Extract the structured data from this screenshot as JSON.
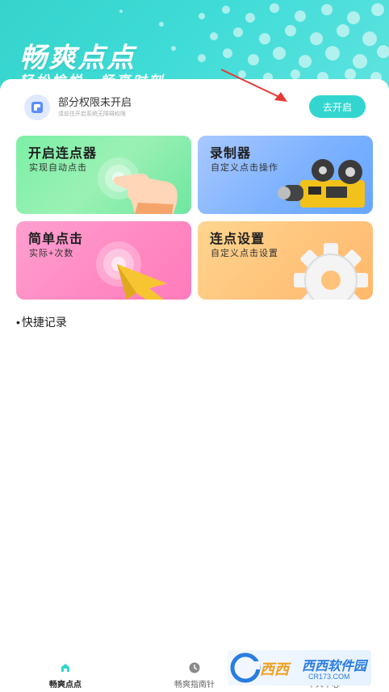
{
  "header": {
    "title": "畅爽点点",
    "subtitle": "轻松愉悦，畅享时刻"
  },
  "permission": {
    "title": "部分权限未开启",
    "subtitle": "请前往开启系统无障碍权限",
    "button_label": "去开启"
  },
  "cards": [
    {
      "title": "开启连点器",
      "subtitle": "实现自动点击",
      "color": "#7cf0a6",
      "icon": "hand-tap-icon"
    },
    {
      "title": "录制器",
      "subtitle": "自定义点击操作",
      "color": "#7db2ff",
      "icon": "film-projector-icon"
    },
    {
      "title": "简单点击",
      "subtitle": "实际+次数",
      "color": "#ff88c2",
      "icon": "cursor-arrow-icon"
    },
    {
      "title": "连点设置",
      "subtitle": "自定义点击设置",
      "color": "#ffc27a",
      "icon": "gear-icon"
    }
  ],
  "section": {
    "label": "快捷记录"
  },
  "bottom_nav": [
    {
      "label": "畅爽点点",
      "icon": "home-icon",
      "active": true
    },
    {
      "label": "畅爽指南针",
      "icon": "clock-icon",
      "active": false
    },
    {
      "label": "个人中心",
      "icon": "user-icon",
      "active": false
    }
  ],
  "watermark": {
    "line1": "西西软件园",
    "line2": "CR173.COM"
  },
  "colors": {
    "accent": "#33d6ce",
    "arrow": "#e53935"
  }
}
